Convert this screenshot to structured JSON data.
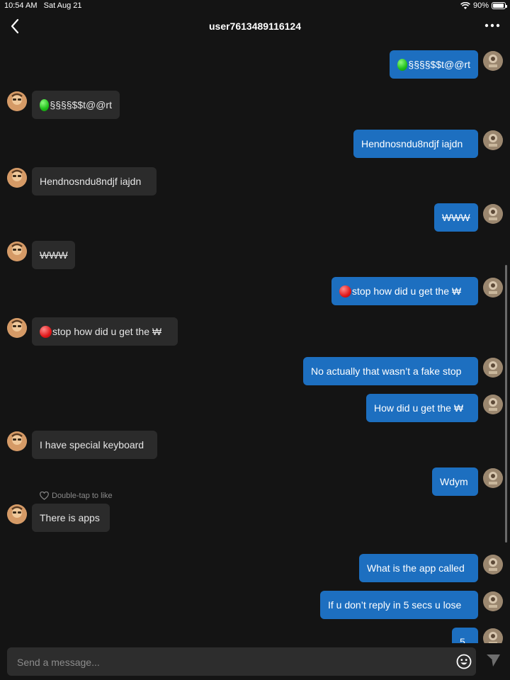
{
  "status_bar": {
    "time": "10:54 AM",
    "date": "Sat Aug 21",
    "battery": "90%"
  },
  "header": {
    "title": "user7613489116124",
    "back_icon": "chevron-left-icon",
    "more_icon": "ellipsis-icon"
  },
  "messages": [
    {
      "dir": "out",
      "text": "§§§§$$t@@rt",
      "emoji": "green"
    },
    {
      "dir": "in",
      "text": "§§§§$$t@@rt",
      "emoji": "green"
    },
    {
      "dir": "out",
      "text": "Hendnosndu8ndjf iajdn"
    },
    {
      "dir": "in",
      "text": "Hendnosndu8ndjf iajdn"
    },
    {
      "dir": "out",
      "text": "WWW",
      "strike": true
    },
    {
      "dir": "in",
      "text": "WWW",
      "strike": true
    },
    {
      "dir": "out",
      "text": "stop how did u get the ₩",
      "emoji": "red"
    },
    {
      "dir": "in",
      "text": "stop how did u get the ₩",
      "emoji": "red"
    },
    {
      "dir": "out",
      "text": "No actually that wasn’t a fake stop"
    },
    {
      "dir": "out",
      "text": "How did u get the ₩"
    },
    {
      "dir": "in",
      "text": "I have special keyboard"
    },
    {
      "dir": "out",
      "text": "Wdym"
    },
    {
      "dir": "in",
      "text": "There is apps"
    },
    {
      "dir": "out",
      "text": "What is the app called"
    },
    {
      "dir": "out",
      "text": "If u don’t reply in 5 secs u lose"
    },
    {
      "dir": "out",
      "text": "5"
    }
  ],
  "like_hint": "Double-tap to like",
  "composer": {
    "placeholder": "Send a message...",
    "emoji_icon": "smiley-icon",
    "send_icon": "send-icon"
  },
  "colors": {
    "background": "#141414",
    "outgoing_bubble": "#1d6fc0",
    "incoming_bubble": "#2b2b2b"
  }
}
